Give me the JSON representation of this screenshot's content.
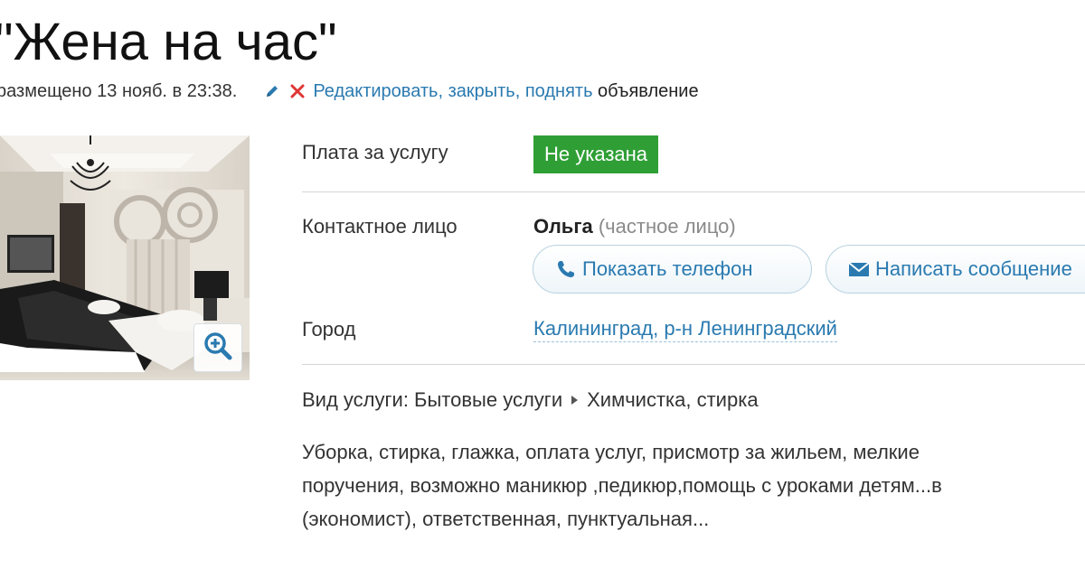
{
  "header": {
    "title": "\"Жена на час\"",
    "posted": "размещено 13 нояб. в 23:38.",
    "edit_icon": "pencil-icon",
    "close_icon": "cross-icon",
    "edit_link": "Редактировать",
    "sep1": ", ",
    "close_link": "закрыть",
    "sep2": ", ",
    "raise_link": "поднять",
    "suffix": " объявление"
  },
  "photo": {
    "zoom_icon": "zoom-in-icon"
  },
  "details": {
    "price_label": "Плата за услугу",
    "price_value": "Не указана",
    "contact_label": "Контактное лицо",
    "contact_name": "Ольга",
    "contact_type": "(частное лицо)",
    "show_phone": "Показать телефон",
    "write_message": "Написать сообщение",
    "city_label": "Город",
    "city_value": "Калининград, р-н Ленинградский",
    "service_label": "Вид услуги: ",
    "service_category": "Бытовые услуги",
    "service_subcategory": "Химчистка, стирка"
  },
  "description": {
    "lines": [
      "Уборка, стирка, глажка, оплата услуг, присмотр за жильем, мелкие",
      "поручения, возможно маникюр ,педикюр,помощь с уроками детям...в",
      "(экономист), ответственная, пунктуальная..."
    ]
  },
  "colors": {
    "link": "#2a7ab0",
    "badge_bg": "#2f9f35",
    "close_red": "#e03535"
  }
}
